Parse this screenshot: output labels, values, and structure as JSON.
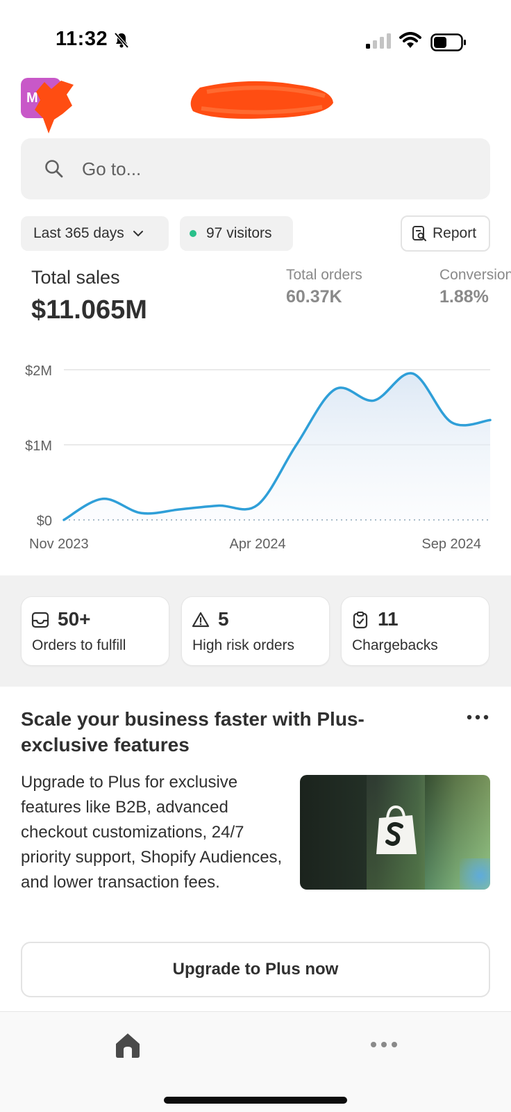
{
  "status_bar": {
    "time": "11:32"
  },
  "avatar": {
    "letter": "M",
    "color": "#c858c8"
  },
  "search": {
    "placeholder": "Go to..."
  },
  "filters": {
    "range_label": "Last 365 days",
    "visitors_label": "97 visitors",
    "report_label": "Report"
  },
  "metrics": {
    "total_sales_label": "Total sales",
    "total_sales_value": "$11.065M",
    "total_orders_label": "Total orders",
    "total_orders_value": "60.37K",
    "conversion_label": "Conversion rate",
    "conversion_value": "1.88%"
  },
  "chart_data": {
    "type": "area",
    "title": "",
    "xlabel": "",
    "ylabel": "",
    "x_ticks": [
      "Nov 2023",
      "Apr 2024",
      "Sep 2024"
    ],
    "y_ticks": [
      "$2M",
      "$1M",
      "$0"
    ],
    "ylim": [
      0,
      2000000
    ],
    "grid": true,
    "series": [
      {
        "color": "#2f9fd8",
        "x": [
          "Nov 2023",
          "Dec 2023",
          "Jan 2024",
          "Feb 2024",
          "Mar 2024",
          "Apr 2024",
          "May 2024",
          "Jun 2024",
          "Jul 2024",
          "Aug 2024",
          "Sep 2024",
          "Oct 2024"
        ],
        "values": [
          0,
          280000,
          90000,
          140000,
          190000,
          200000,
          1000000,
          1740000,
          1590000,
          1950000,
          1300000,
          1330000
        ]
      }
    ]
  },
  "stat_cards": [
    {
      "value": "50+",
      "label": "Orders to fulfill",
      "icon": "inbox-icon"
    },
    {
      "value": "5",
      "label": "High risk orders",
      "icon": "warning-icon"
    },
    {
      "value": "11",
      "label": "Chargebacks",
      "icon": "clipboard-check-icon"
    }
  ],
  "promo": {
    "title": "Scale your business faster with Plus-exclusive features",
    "body": "Upgrade to Plus for exclusive features like B2B, advanced checkout customizations, 24/7 priority support, Shopify Audiences, and lower transaction fees.",
    "image_text": "S",
    "button_label": "Upgrade to Plus now"
  },
  "tab_bar": {
    "items": [
      "home-icon",
      "more-icon"
    ]
  }
}
